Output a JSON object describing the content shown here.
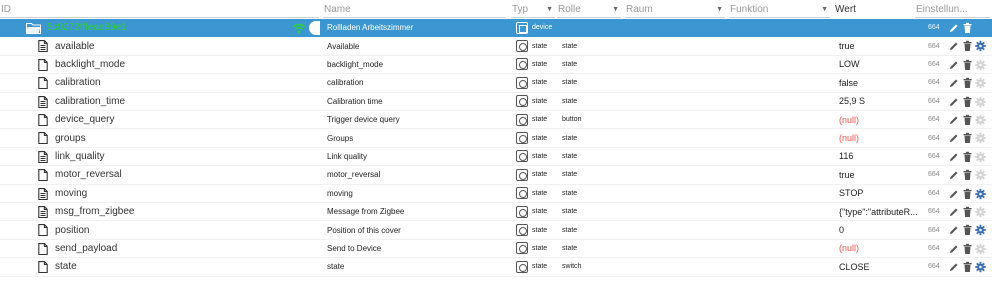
{
  "header": {
    "id": "ID",
    "name": "Name",
    "typ": "Typ",
    "rolle": "Rolle",
    "raum": "Raum",
    "funktion": "Funktion",
    "wert": "Wert",
    "einstellungen": "Einstellun..."
  },
  "device": {
    "id": "5c0272fffeae89e1",
    "name": "Rollladen Arbeitszimmer",
    "typ": "device",
    "acl": "664"
  },
  "rows": [
    {
      "id": "available",
      "name": "Available",
      "typ": "state",
      "rolle": "state",
      "wert": "true",
      "acl": "664",
      "null": false,
      "icon": "file-data-icon",
      "gear": true
    },
    {
      "id": "backlight_mode",
      "name": "backlight_mode",
      "typ": "state",
      "rolle": "state",
      "wert": "LOW",
      "acl": "664",
      "null": false,
      "icon": "file-icon",
      "gear": false
    },
    {
      "id": "calibration",
      "name": "calibration",
      "typ": "state",
      "rolle": "state",
      "wert": "false",
      "acl": "664",
      "null": false,
      "icon": "file-icon",
      "gear": false
    },
    {
      "id": "calibration_time",
      "name": "Calibration time",
      "typ": "state",
      "rolle": "state",
      "wert": "25,9 S",
      "acl": "664",
      "null": false,
      "icon": "file-data-icon",
      "gear": false
    },
    {
      "id": "device_query",
      "name": "Trigger device query",
      "typ": "state",
      "rolle": "button",
      "wert": "(null)",
      "acl": "664",
      "null": true,
      "icon": "file-icon",
      "gear": false
    },
    {
      "id": "groups",
      "name": "Groups",
      "typ": "state",
      "rolle": "state",
      "wert": "(null)",
      "acl": "664",
      "null": true,
      "icon": "file-icon",
      "gear": false
    },
    {
      "id": "link_quality",
      "name": "Link quality",
      "typ": "state",
      "rolle": "state",
      "wert": "116",
      "acl": "664",
      "null": false,
      "icon": "file-data-icon",
      "gear": false
    },
    {
      "id": "motor_reversal",
      "name": "motor_reversal",
      "typ": "state",
      "rolle": "state",
      "wert": "true",
      "acl": "664",
      "null": false,
      "icon": "file-icon",
      "gear": false
    },
    {
      "id": "moving",
      "name": "moving",
      "typ": "state",
      "rolle": "state",
      "wert": "STOP",
      "acl": "664",
      "null": false,
      "icon": "file-data-icon",
      "gear": true
    },
    {
      "id": "msg_from_zigbee",
      "name": "Message from Zigbee",
      "typ": "state",
      "rolle": "state",
      "wert": "{\"type\":\"attributeR...",
      "acl": "664",
      "null": false,
      "icon": "file-data-icon",
      "gear": false
    },
    {
      "id": "position",
      "name": "Position of this cover",
      "typ": "state",
      "rolle": "state",
      "wert": "0",
      "acl": "664",
      "null": false,
      "icon": "file-icon",
      "gear": true
    },
    {
      "id": "send_payload",
      "name": "Send to Device",
      "typ": "state",
      "rolle": "state",
      "wert": "(null)",
      "acl": "664",
      "null": true,
      "icon": "file-icon",
      "gear": false
    },
    {
      "id": "state",
      "name": "state",
      "typ": "state",
      "rolle": "switch",
      "wert": "CLOSE",
      "acl": "664",
      "null": false,
      "icon": "file-icon",
      "gear": true
    }
  ],
  "colors": {
    "selected_row": "#3c96d1",
    "id_highlight": "#2ecc40",
    "null_value": "#e8524b",
    "gear_active": "#3c6fa8",
    "gear_inactive": "#d2d2d2"
  }
}
